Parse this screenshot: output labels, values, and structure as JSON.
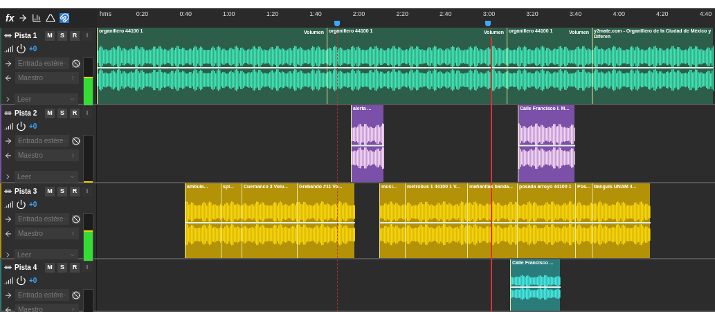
{
  "toolbar": {
    "fx_label": "fx"
  },
  "ruler": {
    "unit": "hms",
    "ticks": [
      "0:20",
      "0:40",
      "1:00",
      "1:20",
      "1:40",
      "2:00",
      "2:20",
      "2:40",
      "3:00",
      "3:20",
      "3:40",
      "4:00",
      "4:20",
      "4:40"
    ]
  },
  "tracks": [
    {
      "name": "Pista 1",
      "buttons": [
        "M",
        "S",
        "R",
        "I"
      ],
      "volume": "+0",
      "input": "Entrada estére",
      "output": "Maestro",
      "automation": "Leer",
      "level": 0.6,
      "color": "#2d5e4a",
      "clips": [
        {
          "name": "organillero  44100 1",
          "envelope_label": "Volumen"
        },
        {
          "name": "organillero  44100 1",
          "envelope_label": "Volumen"
        },
        {
          "name": "organillero  44100 1",
          "envelope_label": "Volumen"
        },
        {
          "name": "y2mate.com - Organillero de la Ciudad de México y Diferen"
        }
      ]
    },
    {
      "name": "Pista 2",
      "buttons": [
        "M",
        "S",
        "R",
        "I"
      ],
      "volume": "+0",
      "input": "Entrada estére",
      "output": "Maestro",
      "automation": "Leer",
      "level": 0.03,
      "color": "#7a50a8",
      "clips": [
        {
          "name": "alerta ..."
        },
        {
          "name": "Calle Francisco I. M..."
        }
      ]
    },
    {
      "name": "Pista 3",
      "buttons": [
        "M",
        "S",
        "R",
        "I"
      ],
      "volume": "+0",
      "input": "Entrada estére",
      "output": "Maestro",
      "automation": "Leer",
      "level": 0.65,
      "color": "#b39208",
      "clips": [
        {
          "name": "ambula..."
        },
        {
          "name": "spi..."
        },
        {
          "name": "Cuemanco 3 Volu..."
        },
        {
          "name": "Grabando #11 Vo..."
        },
        {
          "name": "músi..."
        },
        {
          "name": "metrobus 1 44100 1 V..."
        },
        {
          "name": "mañanitas banda..."
        },
        {
          "name": "posada arroyo  44100 1"
        },
        {
          "name": "Pos..."
        },
        {
          "name": "tianguis UNAM  4..."
        }
      ]
    },
    {
      "name": "Pista 4",
      "buttons": [
        "M",
        "S",
        "R",
        "I"
      ],
      "volume": "+0",
      "input": "Entrada estére",
      "output": "Maestro",
      "color": "#2a7c7a",
      "clips": [
        {
          "name": "Calle Francisco ..."
        }
      ]
    }
  ]
}
